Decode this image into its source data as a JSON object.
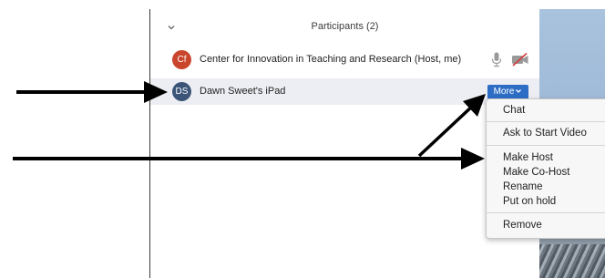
{
  "panel": {
    "title": "Participants (2)"
  },
  "participants": [
    {
      "initials": "Cf",
      "name": "Center for Innovation in Teaching and Research (Host, me)",
      "avatar_color": "#c9452c"
    },
    {
      "initials": "DS",
      "name": "Dawn Sweet's iPad",
      "avatar_color": "#3b5478"
    }
  ],
  "more_button": {
    "label": "More",
    "color": "#2d6dc6"
  },
  "context_menu": {
    "items": [
      "Chat",
      "Ask to Start Video",
      "Make Host",
      "Make Co-Host",
      "Rename",
      "Put on hold",
      "Remove"
    ]
  },
  "icons": {
    "collapse": "chevron-down-icon",
    "mic": "microphone-icon",
    "video": "video-off-icon",
    "more": "chevron-down-icon"
  }
}
